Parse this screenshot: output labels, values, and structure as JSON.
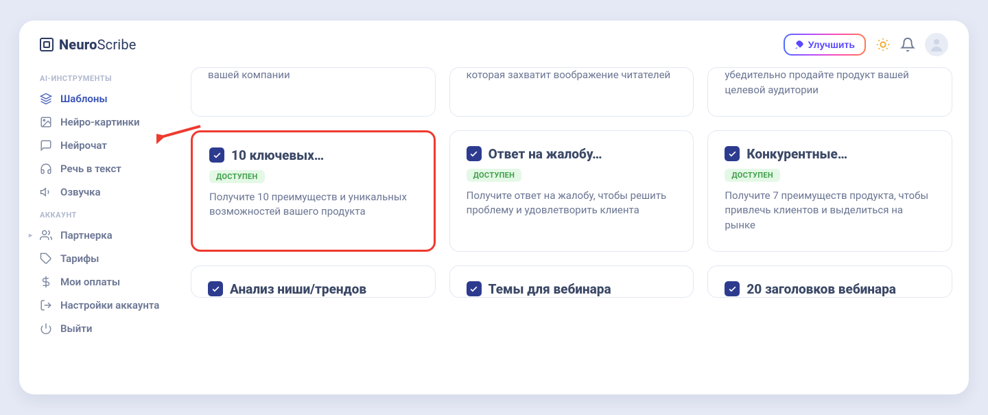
{
  "brand": {
    "bold": "Neuro",
    "light": "Scribe"
  },
  "header": {
    "upgrade_label": "Улучшить"
  },
  "sidebar": {
    "section_ai": "AI-ИНСТРУМЕНТЫ",
    "section_account": "АККАУНТ",
    "ai_items": [
      {
        "label": "Шаблоны",
        "icon": "layers"
      },
      {
        "label": "Нейро-картинки",
        "icon": "image"
      },
      {
        "label": "Нейрочат",
        "icon": "chat"
      },
      {
        "label": "Речь в текст",
        "icon": "headphones"
      },
      {
        "label": "Озвучка",
        "icon": "volume"
      }
    ],
    "account_items": [
      {
        "label": "Партнерка",
        "icon": "users",
        "caret": true
      },
      {
        "label": "Тарифы",
        "icon": "tag"
      },
      {
        "label": "Мои оплаты",
        "icon": "dollar"
      },
      {
        "label": "Настройки аккаунта",
        "icon": "logout"
      },
      {
        "label": "Выйти",
        "icon": "power"
      }
    ]
  },
  "status_available": "ДОСТУПЕН",
  "cards_row_top": [
    {
      "desc": "вашей компании"
    },
    {
      "desc": "которая захватит воображение читателей"
    },
    {
      "desc": "убедительно продайте продукт вашей целевой аудитории"
    }
  ],
  "cards_row_mid": [
    {
      "title": "10 ключевых…",
      "desc": "Получите 10 преимуществ и уникальных возможностей вашего продукта"
    },
    {
      "title": "Ответ на жалобу…",
      "desc": "Получите ответ на жалобу, чтобы решить проблему и удовлетворить клиента"
    },
    {
      "title": "Конкурентные…",
      "desc": "Получите 7 преимуществ продукта, чтобы привлечь клиентов и выделиться на рынке"
    }
  ],
  "cards_row_bottom": [
    {
      "title": "Анализ ниши/трендов"
    },
    {
      "title": "Темы для вебинара"
    },
    {
      "title": "20 заголовков вебинара"
    }
  ]
}
